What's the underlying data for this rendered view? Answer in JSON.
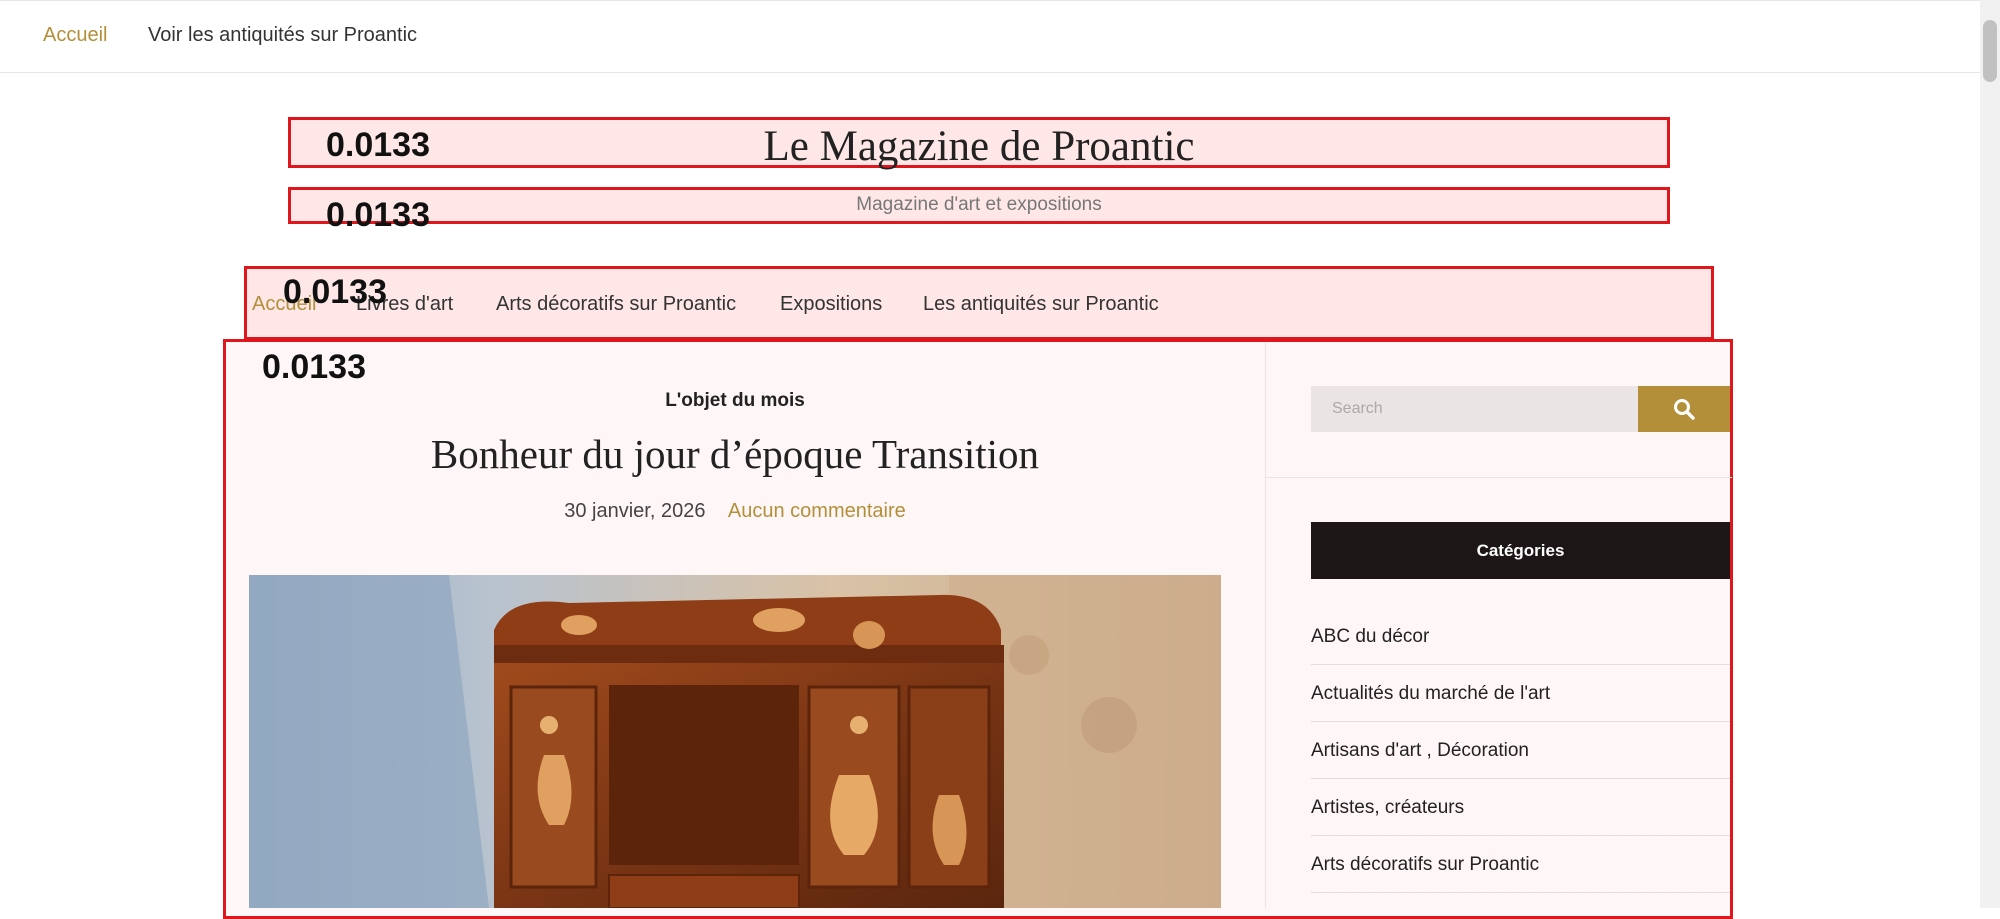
{
  "colors": {
    "accent": "#b38f3a",
    "annotation": "#e0161d",
    "category_header_bg": "#1c1617"
  },
  "top_nav": {
    "items": [
      {
        "label": "Accueil",
        "active": true
      },
      {
        "label": "Voir les antiquités sur Proantic",
        "active": false
      }
    ]
  },
  "site": {
    "title": "Le Magazine de Proantic",
    "tagline": "Magazine d'art et expositions"
  },
  "main_nav": {
    "items": [
      {
        "label": "Accueil",
        "active": true
      },
      {
        "label": "Livres d'art"
      },
      {
        "label": "Arts décoratifs sur Proantic"
      },
      {
        "label": "Expositions"
      },
      {
        "label": "Les antiquités sur Proantic"
      }
    ]
  },
  "annotations": {
    "title_score": "0.0133",
    "tagline_score": "0.0133",
    "nav_score": "0.0133",
    "content_score": "0.0133"
  },
  "post": {
    "category": "L'objet du mois",
    "title": "Bonheur du jour d’époque Transition",
    "date": "30 janvier, 2026",
    "comments": "Aucun commentaire",
    "image_icon": "antique-cabinet-photo"
  },
  "sidebar": {
    "search": {
      "placeholder": "Search",
      "value": "",
      "icon": "search-icon"
    },
    "categories_title": "Catégories",
    "categories": [
      "ABC du décor",
      "Actualités du marché de l'art",
      "Artisans d'art , Décoration",
      "Artistes, créateurs",
      "Arts décoratifs sur Proantic"
    ]
  }
}
